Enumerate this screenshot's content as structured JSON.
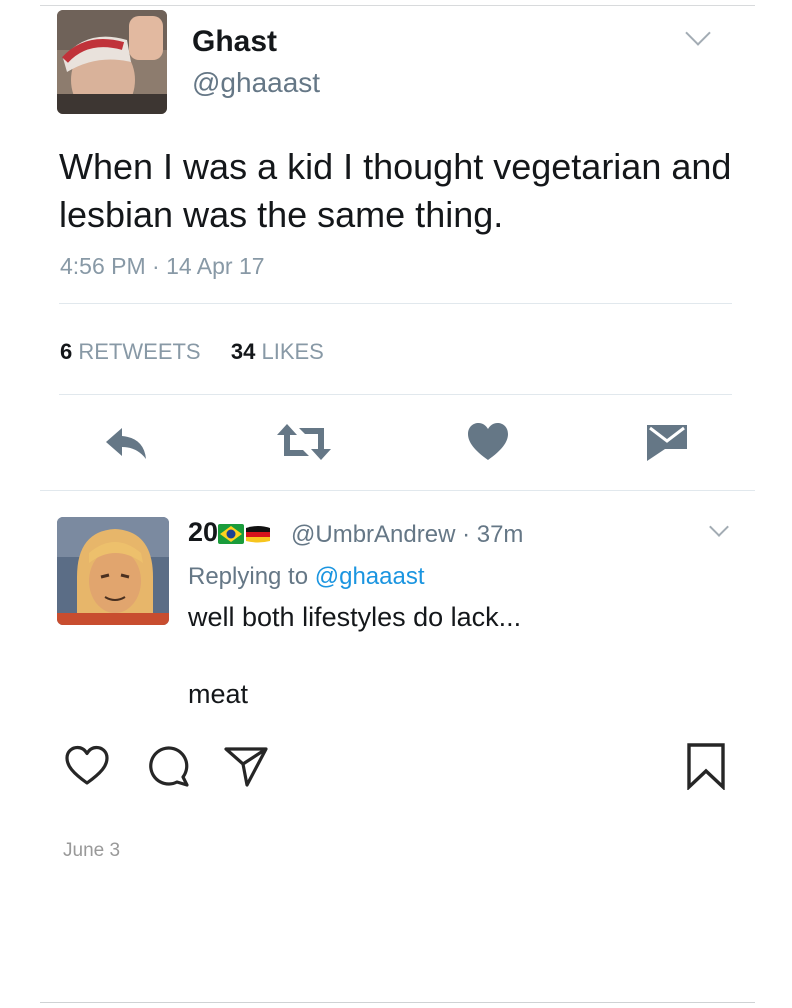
{
  "tweet": {
    "name": "Ghast",
    "handle": "@ghaaast",
    "text_line1": "When I was a kid I thought vegetarian and",
    "text_line2": "lesbian was the same thing.",
    "timestamp": "4:56 PM · 14 Apr 17",
    "retweets_count": "6",
    "retweets_label": "RETWEETS",
    "likes_count": "34",
    "likes_label": "LIKES",
    "actions": [
      "reply-icon",
      "retweet-icon",
      "heart-icon",
      "direct-message-icon"
    ]
  },
  "reply": {
    "name": "20",
    "name_flags": [
      "brazil-flag",
      "germany-flag"
    ],
    "handle_time": "@UmbrAndrew · 37m",
    "replying_prefix": "Replying to",
    "replying_to": "@ghaaast",
    "text_line1": "well both lifestyles do lack...",
    "text_line2": "meat"
  },
  "post": {
    "actions": [
      "heart-outline-icon",
      "comment-icon",
      "share-icon",
      "bookmark-icon"
    ],
    "date": "June 3"
  },
  "colors": {
    "primary_text": "#14171a",
    "secondary_text": "#657786",
    "link": "#1b95e0",
    "icon": "#657786"
  }
}
